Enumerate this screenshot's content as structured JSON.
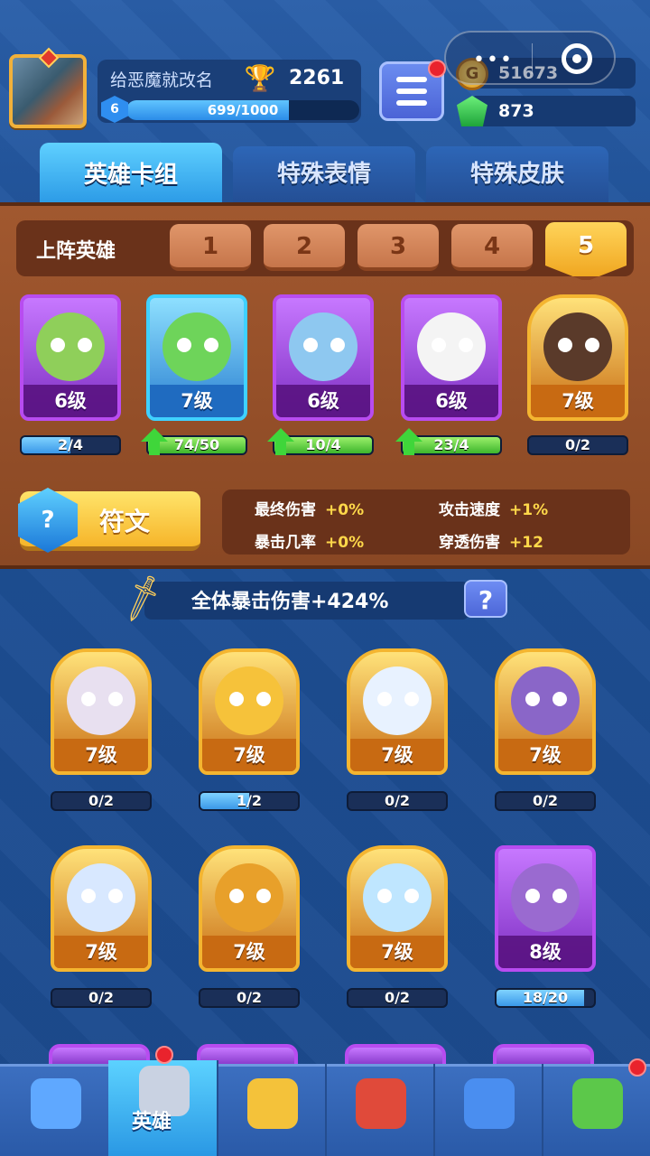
{
  "player": {
    "name": "给恶魔就改名",
    "trophies": "2261",
    "level": "6",
    "xp_text": "699/1000",
    "xp_progress": 0.699
  },
  "currency": {
    "coins": "51673",
    "gems": "873",
    "coin_icon": "coin-icon",
    "gem_icon": "gem-icon"
  },
  "tabs": [
    {
      "label": "英雄卡组"
    },
    {
      "label": "特殊表情"
    },
    {
      "label": "特殊皮肤"
    }
  ],
  "deck": {
    "label": "上阵英雄",
    "slots": [
      "1",
      "2",
      "3",
      "4",
      "5"
    ],
    "selected": "5"
  },
  "team_heroes": [
    {
      "level": "6级",
      "progress": "2/4",
      "fill": 0.5,
      "upgrade": false,
      "frame": "purple",
      "color": "#8fcf5a"
    },
    {
      "level": "7级",
      "progress": "74/50",
      "fill": 1.0,
      "upgrade": true,
      "frame": "blue",
      "color": "#6ed45a"
    },
    {
      "level": "6级",
      "progress": "10/4",
      "fill": 1.0,
      "upgrade": true,
      "frame": "purple",
      "color": "#8ec8f0"
    },
    {
      "level": "6级",
      "progress": "23/4",
      "fill": 1.0,
      "upgrade": true,
      "frame": "purple",
      "color": "#f4f4f4"
    },
    {
      "level": "7级",
      "progress": "0/2",
      "fill": 0.0,
      "upgrade": false,
      "frame": "gold",
      "color": "#5a3a2a"
    }
  ],
  "rune": {
    "label": "符文",
    "icon": "rune-icon",
    "icon_glyph": "?"
  },
  "stats": [
    {
      "label": "最终伤害",
      "value": "+0%"
    },
    {
      "label": "攻击速度",
      "value": "+1%"
    },
    {
      "label": "暴击几率",
      "value": "+0%"
    },
    {
      "label": "穿透伤害",
      "value": "+12"
    }
  ],
  "crit_bonus": "全体暴击伤害+424%",
  "help_label": "?",
  "collection": [
    {
      "level": "7级",
      "progress": "0/2",
      "fill": 0.0,
      "frame": "gold",
      "color": "#e8e0f0"
    },
    {
      "level": "7级",
      "progress": "1/2",
      "fill": 0.5,
      "frame": "gold",
      "color": "#f6c23a"
    },
    {
      "level": "7级",
      "progress": "0/2",
      "fill": 0.0,
      "frame": "gold",
      "color": "#e8f2ff"
    },
    {
      "level": "7级",
      "progress": "0/2",
      "fill": 0.0,
      "frame": "gold",
      "color": "#8a66c8"
    },
    {
      "level": "7级",
      "progress": "0/2",
      "fill": 0.0,
      "frame": "gold",
      "color": "#d8e8ff"
    },
    {
      "level": "7级",
      "progress": "0/2",
      "fill": 0.0,
      "frame": "gold",
      "color": "#e8a02a"
    },
    {
      "level": "7级",
      "progress": "0/2",
      "fill": 0.0,
      "frame": "gold",
      "color": "#bfe6ff"
    },
    {
      "level": "8级",
      "progress": "18/20",
      "fill": 0.9,
      "frame": "purple",
      "color": "#9a6ad0"
    }
  ],
  "nav": [
    {
      "label": "",
      "icon": "chest-icon",
      "color": "#5fa8ff"
    },
    {
      "label": "英雄",
      "icon": "helmet-icon",
      "color": "#c9d2e2",
      "active": true
    },
    {
      "label": "",
      "icon": "swords-icon",
      "color": "#f4c23a"
    },
    {
      "label": "",
      "icon": "crown-shield-icon",
      "color": "#e04a3a"
    },
    {
      "label": "",
      "icon": "guild-banner-icon",
      "color": "#4a8ef0"
    },
    {
      "label": "",
      "icon": "sprout-icon",
      "color": "#5cc84a"
    }
  ],
  "colors": {
    "accent": "#2b9ae6",
    "gold": "#f4b530",
    "panel_brown": "#8a4824",
    "upgrade_green": "#3fd63a"
  }
}
